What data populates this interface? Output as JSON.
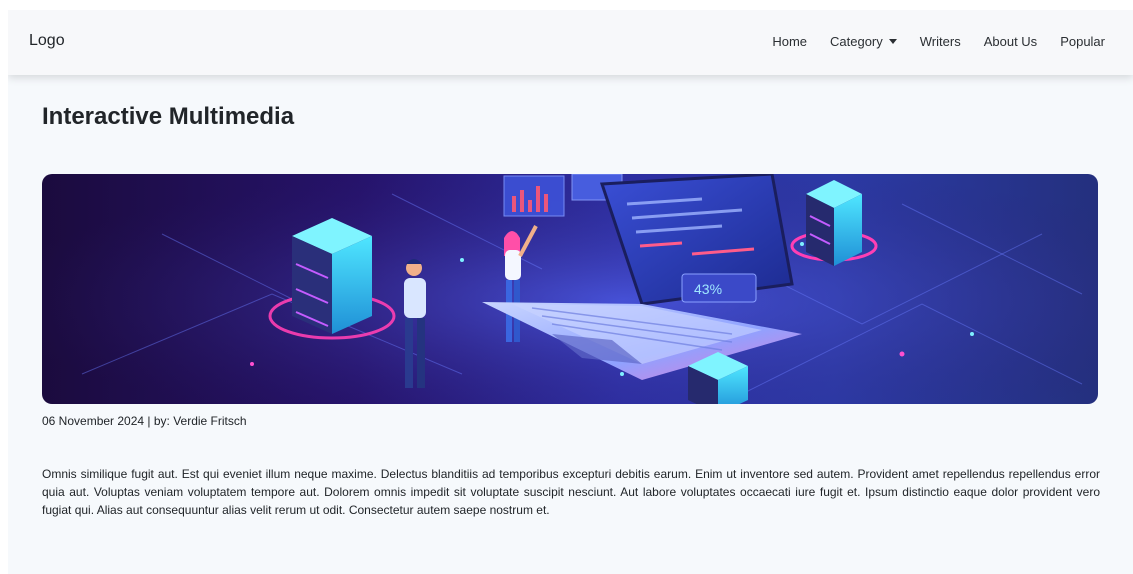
{
  "navbar": {
    "brand": "Logo",
    "items": [
      {
        "label": "Home"
      },
      {
        "label": "Category",
        "dropdown": true
      },
      {
        "label": "Writers"
      },
      {
        "label": "About Us"
      },
      {
        "label": "Popular"
      }
    ]
  },
  "article": {
    "title": "Interactive Multimedia",
    "hero_image": {
      "icon": "isometric-laptop-servers-illustration-icon",
      "badge": "43%"
    },
    "meta": "06 November 2024 | by: Verdie Fritsch",
    "body": "Omnis similique fugit aut. Est qui eveniet illum neque maxime. Delectus blanditiis ad temporibus excepturi debitis earum. Enim ut inventore sed autem. Provident amet repellendus repellendus error quia aut. Voluptas veniam voluptatem tempore aut. Dolorem omnis impedit sit voluptate suscipit nesciunt. Aut labore voluptates occaecati iure fugit et. Ipsum distinctio eaque dolor provident vero fugiat qui. Alias aut consequuntur alias velit rerum ut odit. Consectetur autem saepe nostrum et."
  },
  "colors": {
    "page_bg": "#f6f9fc",
    "navbar_bg": "#f7f8fa",
    "text": "#212529",
    "hero_dark": "#1b0b3e",
    "hero_blue": "#2d2fa3",
    "neon_pink": "#ff3fb4",
    "neon_cyan": "#3fe0ff"
  }
}
